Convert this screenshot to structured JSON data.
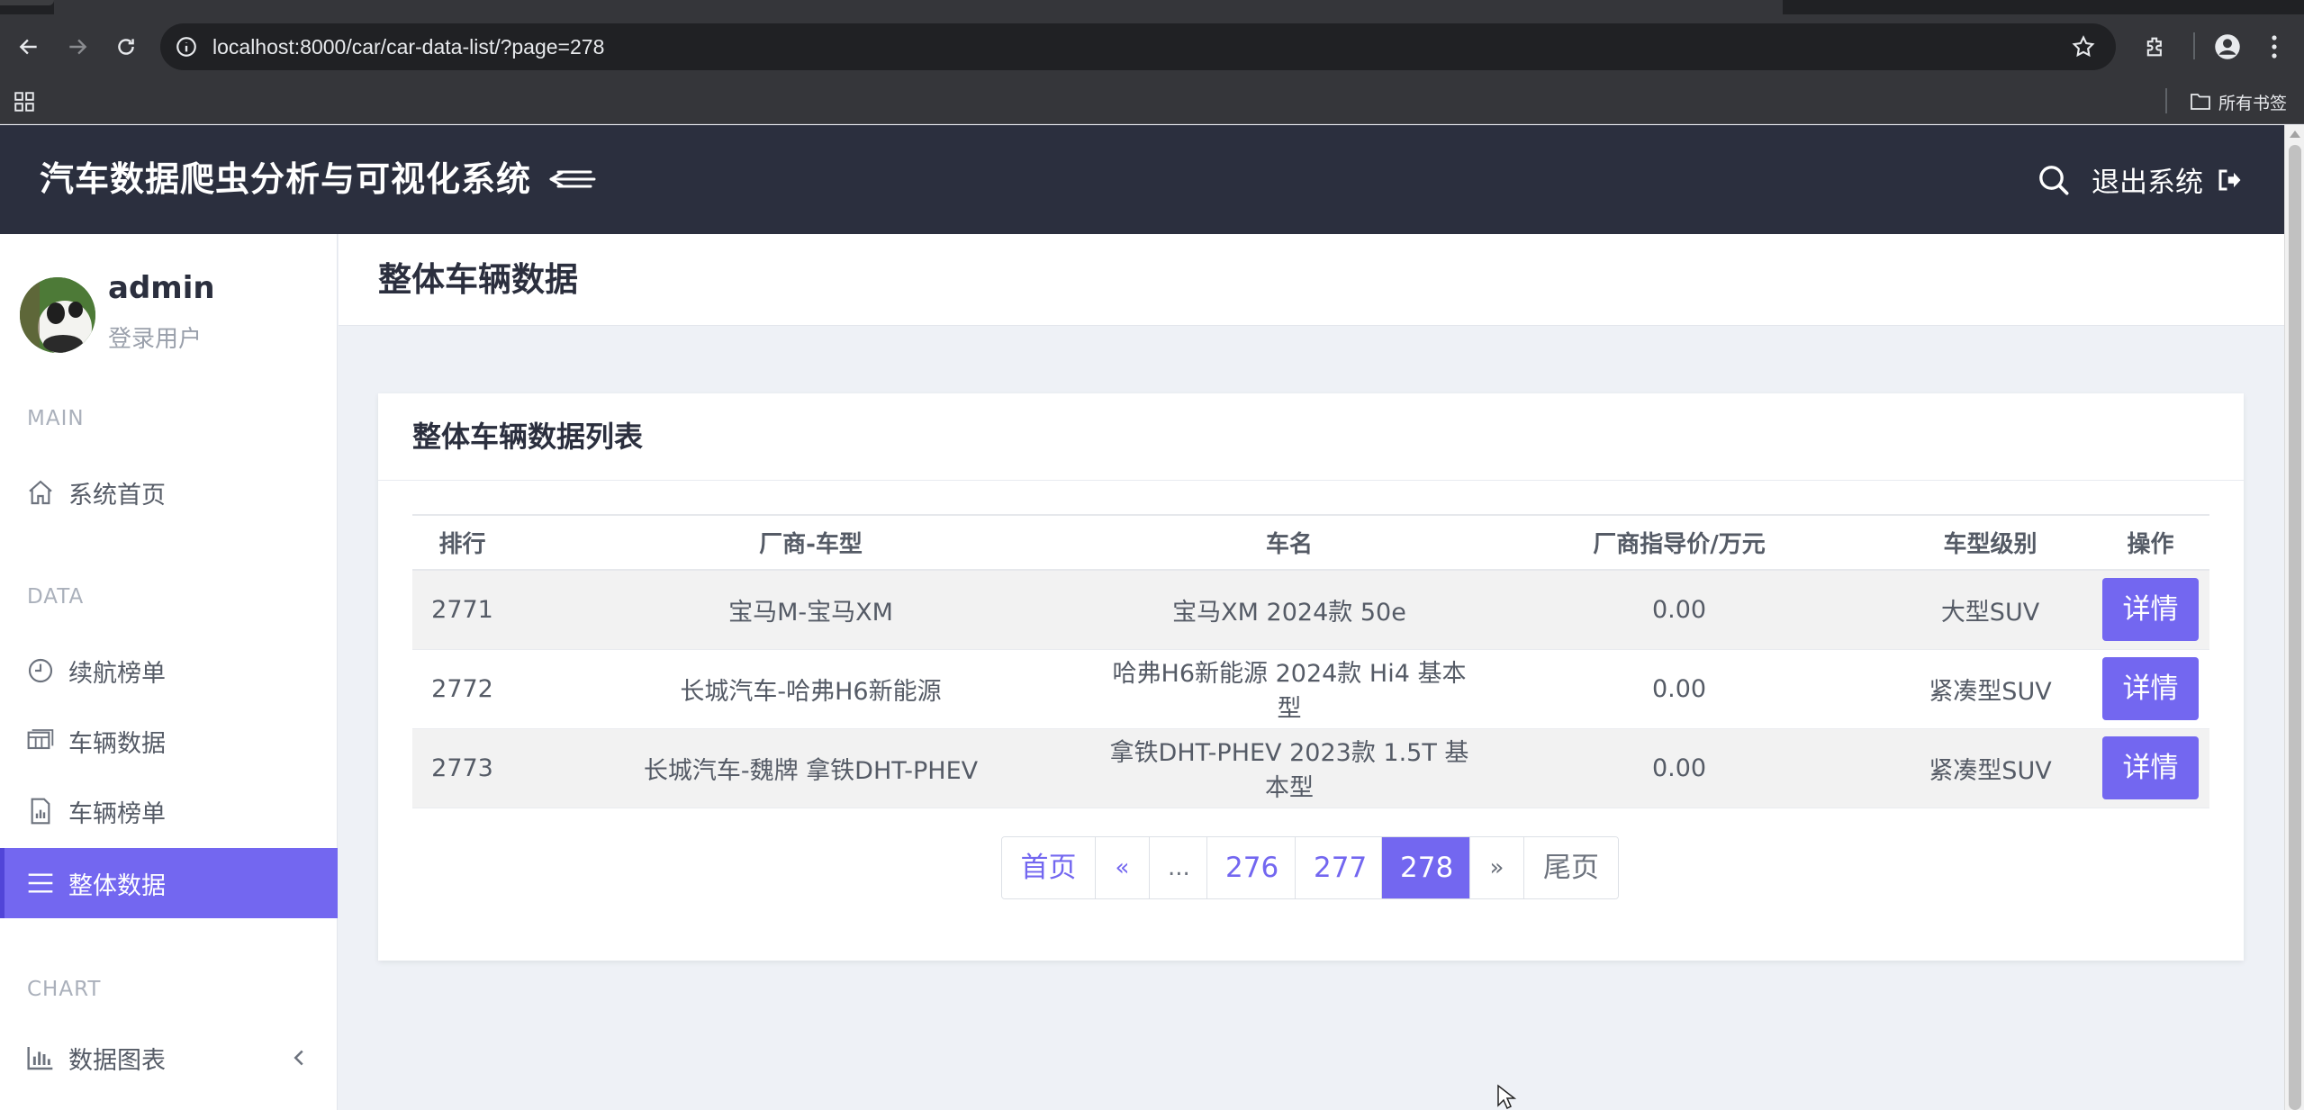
{
  "browser": {
    "url": "localhost:8000/car/car-data-list/?page=278",
    "bookmarks_folder": "所有书签"
  },
  "header": {
    "brand": "汽车数据爬虫分析与可视化系统",
    "logout_label": "退出系统"
  },
  "sidebar": {
    "user_name": "admin",
    "user_role": "登录用户",
    "sections": [
      {
        "label": "MAIN"
      },
      {
        "label": "DATA"
      },
      {
        "label": "CHART"
      }
    ],
    "items": [
      {
        "label": "系统首页",
        "icon": "home-icon"
      },
      {
        "label": "续航榜单",
        "icon": "clock-icon"
      },
      {
        "label": "车辆数据",
        "icon": "table-icon"
      },
      {
        "label": "车辆榜单",
        "icon": "report-icon"
      },
      {
        "label": "整体数据",
        "icon": "list-icon",
        "active": true
      },
      {
        "label": "数据图表",
        "icon": "bar-chart-icon"
      }
    ]
  },
  "page": {
    "title": "整体车辆数据",
    "card_title": "整体车辆数据列表"
  },
  "table": {
    "columns": [
      "排行",
      "厂商-车型",
      "车名",
      "厂商指导价/万元",
      "车型级别",
      "操作"
    ],
    "rows": [
      {
        "rank": "2771",
        "maker_model": "宝马M-宝马XM",
        "name": "宝马XM 2024款 50e",
        "price": "0.00",
        "level": "大型SUV",
        "action": "详情"
      },
      {
        "rank": "2772",
        "maker_model": "长城汽车-哈弗H6新能源",
        "name": "哈弗H6新能源 2024款 Hi4 基本型",
        "price": "0.00",
        "level": "紧凑型SUV",
        "action": "详情"
      },
      {
        "rank": "2773",
        "maker_model": "长城汽车-魏牌 拿铁DHT-PHEV",
        "name": "拿铁DHT-PHEV 2023款 1.5T 基本型",
        "price": "0.00",
        "level": "紧凑型SUV",
        "action": "详情"
      }
    ]
  },
  "pagination": {
    "first": "首页",
    "prev": "«",
    "ellipsis": "...",
    "pages": [
      "276",
      "277",
      "278"
    ],
    "current": "278",
    "next": "»",
    "last": "尾页"
  },
  "colors": {
    "accent": "#7367f0",
    "header_bg": "#2b2f3e",
    "content_bg": "#eef1f6"
  }
}
